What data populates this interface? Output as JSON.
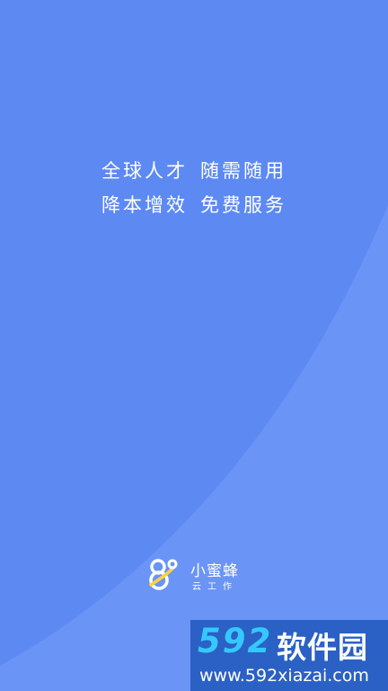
{
  "splash": {
    "slogan_line1_a": "全球人才",
    "slogan_line1_b": "随需随用",
    "slogan_line2_a": "降本增效",
    "slogan_line2_b": "免费服务"
  },
  "brand": {
    "name": "小蜜蜂",
    "subtitle": "云工作"
  },
  "watermark": {
    "number": "592",
    "site_name": "软件园",
    "url": "www.592xiazai.com"
  },
  "colors": {
    "background": "#5d89f3",
    "watermark_bg": "#2b61c4",
    "watermark_accent": "#35c8ff",
    "logo_accent": "#ffd23c",
    "text": "#ffffff"
  },
  "icons": {
    "brand_logo": "bee-logo-icon"
  }
}
